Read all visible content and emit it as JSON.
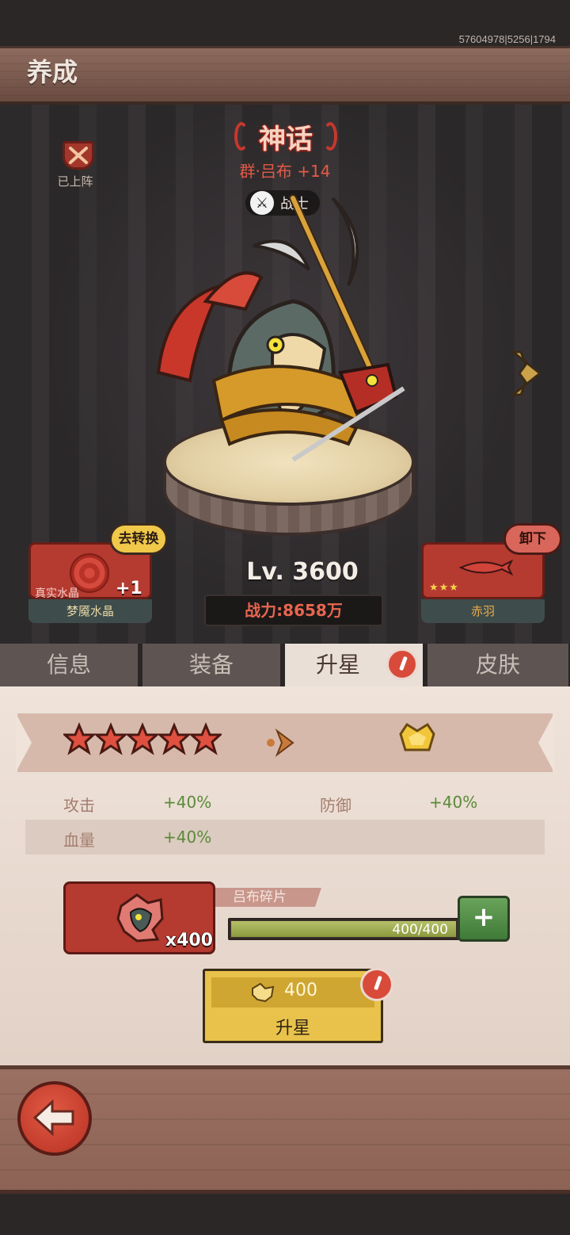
{
  "header": {
    "build_id": "57604978|5256|1794",
    "title": "养成"
  },
  "hero": {
    "deployed_label": "已上阵",
    "rarity": "神话",
    "name": "群·吕布 +14",
    "class": "战士",
    "level": "Lv. 3600",
    "power": "战力:8658万"
  },
  "left_item": {
    "sublabel": "真实水晶",
    "bonus": "+1",
    "name": "梦魇水晶",
    "action": "去转换"
  },
  "right_item": {
    "name": "赤羽",
    "stars": 3,
    "action": "卸下"
  },
  "tabs": [
    {
      "label": "信息",
      "active": false
    },
    {
      "label": "装备",
      "active": false
    },
    {
      "label": "升星",
      "active": true,
      "alert": true
    },
    {
      "label": "皮肤",
      "active": false
    }
  ],
  "star_upgrade": {
    "current_stars": 5,
    "stats": [
      {
        "name": "攻击",
        "value": "+40%"
      },
      {
        "name": "防御",
        "value": "+40%"
      },
      {
        "name": "血量",
        "value": "+40%"
      }
    ],
    "shard": {
      "label": "吕布碎片",
      "count": "x400",
      "progress_text": "400/400",
      "progress": 1.0
    },
    "cost": "400",
    "button_label": "升星"
  },
  "colors": {
    "accent_red": "#b53a30",
    "gold": "#e8c24a",
    "green": "#5a8a3a",
    "alert": "#d84b3a"
  }
}
